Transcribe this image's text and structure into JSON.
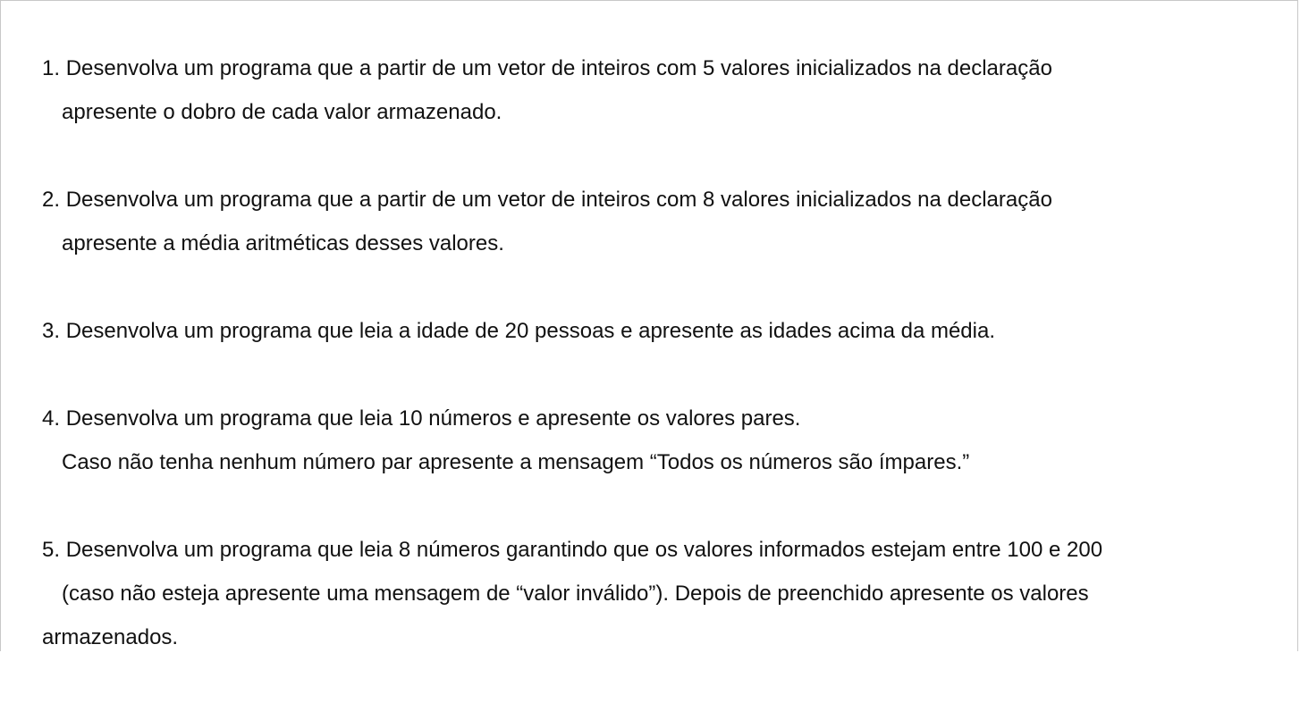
{
  "exercises": [
    {
      "number": "1.",
      "lines": [
        "Desenvolva um programa que a partir de um vetor de inteiros com 5 valores inicializados na declaração",
        "apresente o dobro de cada valor armazenado."
      ]
    },
    {
      "number": "2.",
      "lines": [
        "Desenvolva um programa que a partir de um vetor de inteiros com 8 valores inicializados na declaração",
        "apresente a média aritméticas desses valores."
      ]
    },
    {
      "number": "3.",
      "lines": [
        "Desenvolva um programa que leia a idade de 20 pessoas e apresente as idades acima da média."
      ]
    },
    {
      "number": "4.",
      "lines": [
        "Desenvolva um programa que leia 10 números e apresente os valores pares.",
        "Caso não tenha nenhum número par apresente a mensagem “Todos os números são ímpares.”"
      ]
    },
    {
      "number": "5.",
      "lines": [
        "Desenvolva um programa que leia 8 números garantindo que os valores informados estejam entre 100 e 200",
        "(caso não esteja apresente uma mensagem de “valor inválido”). Depois de preenchido apresente os valores",
        "armazenados."
      ]
    }
  ]
}
